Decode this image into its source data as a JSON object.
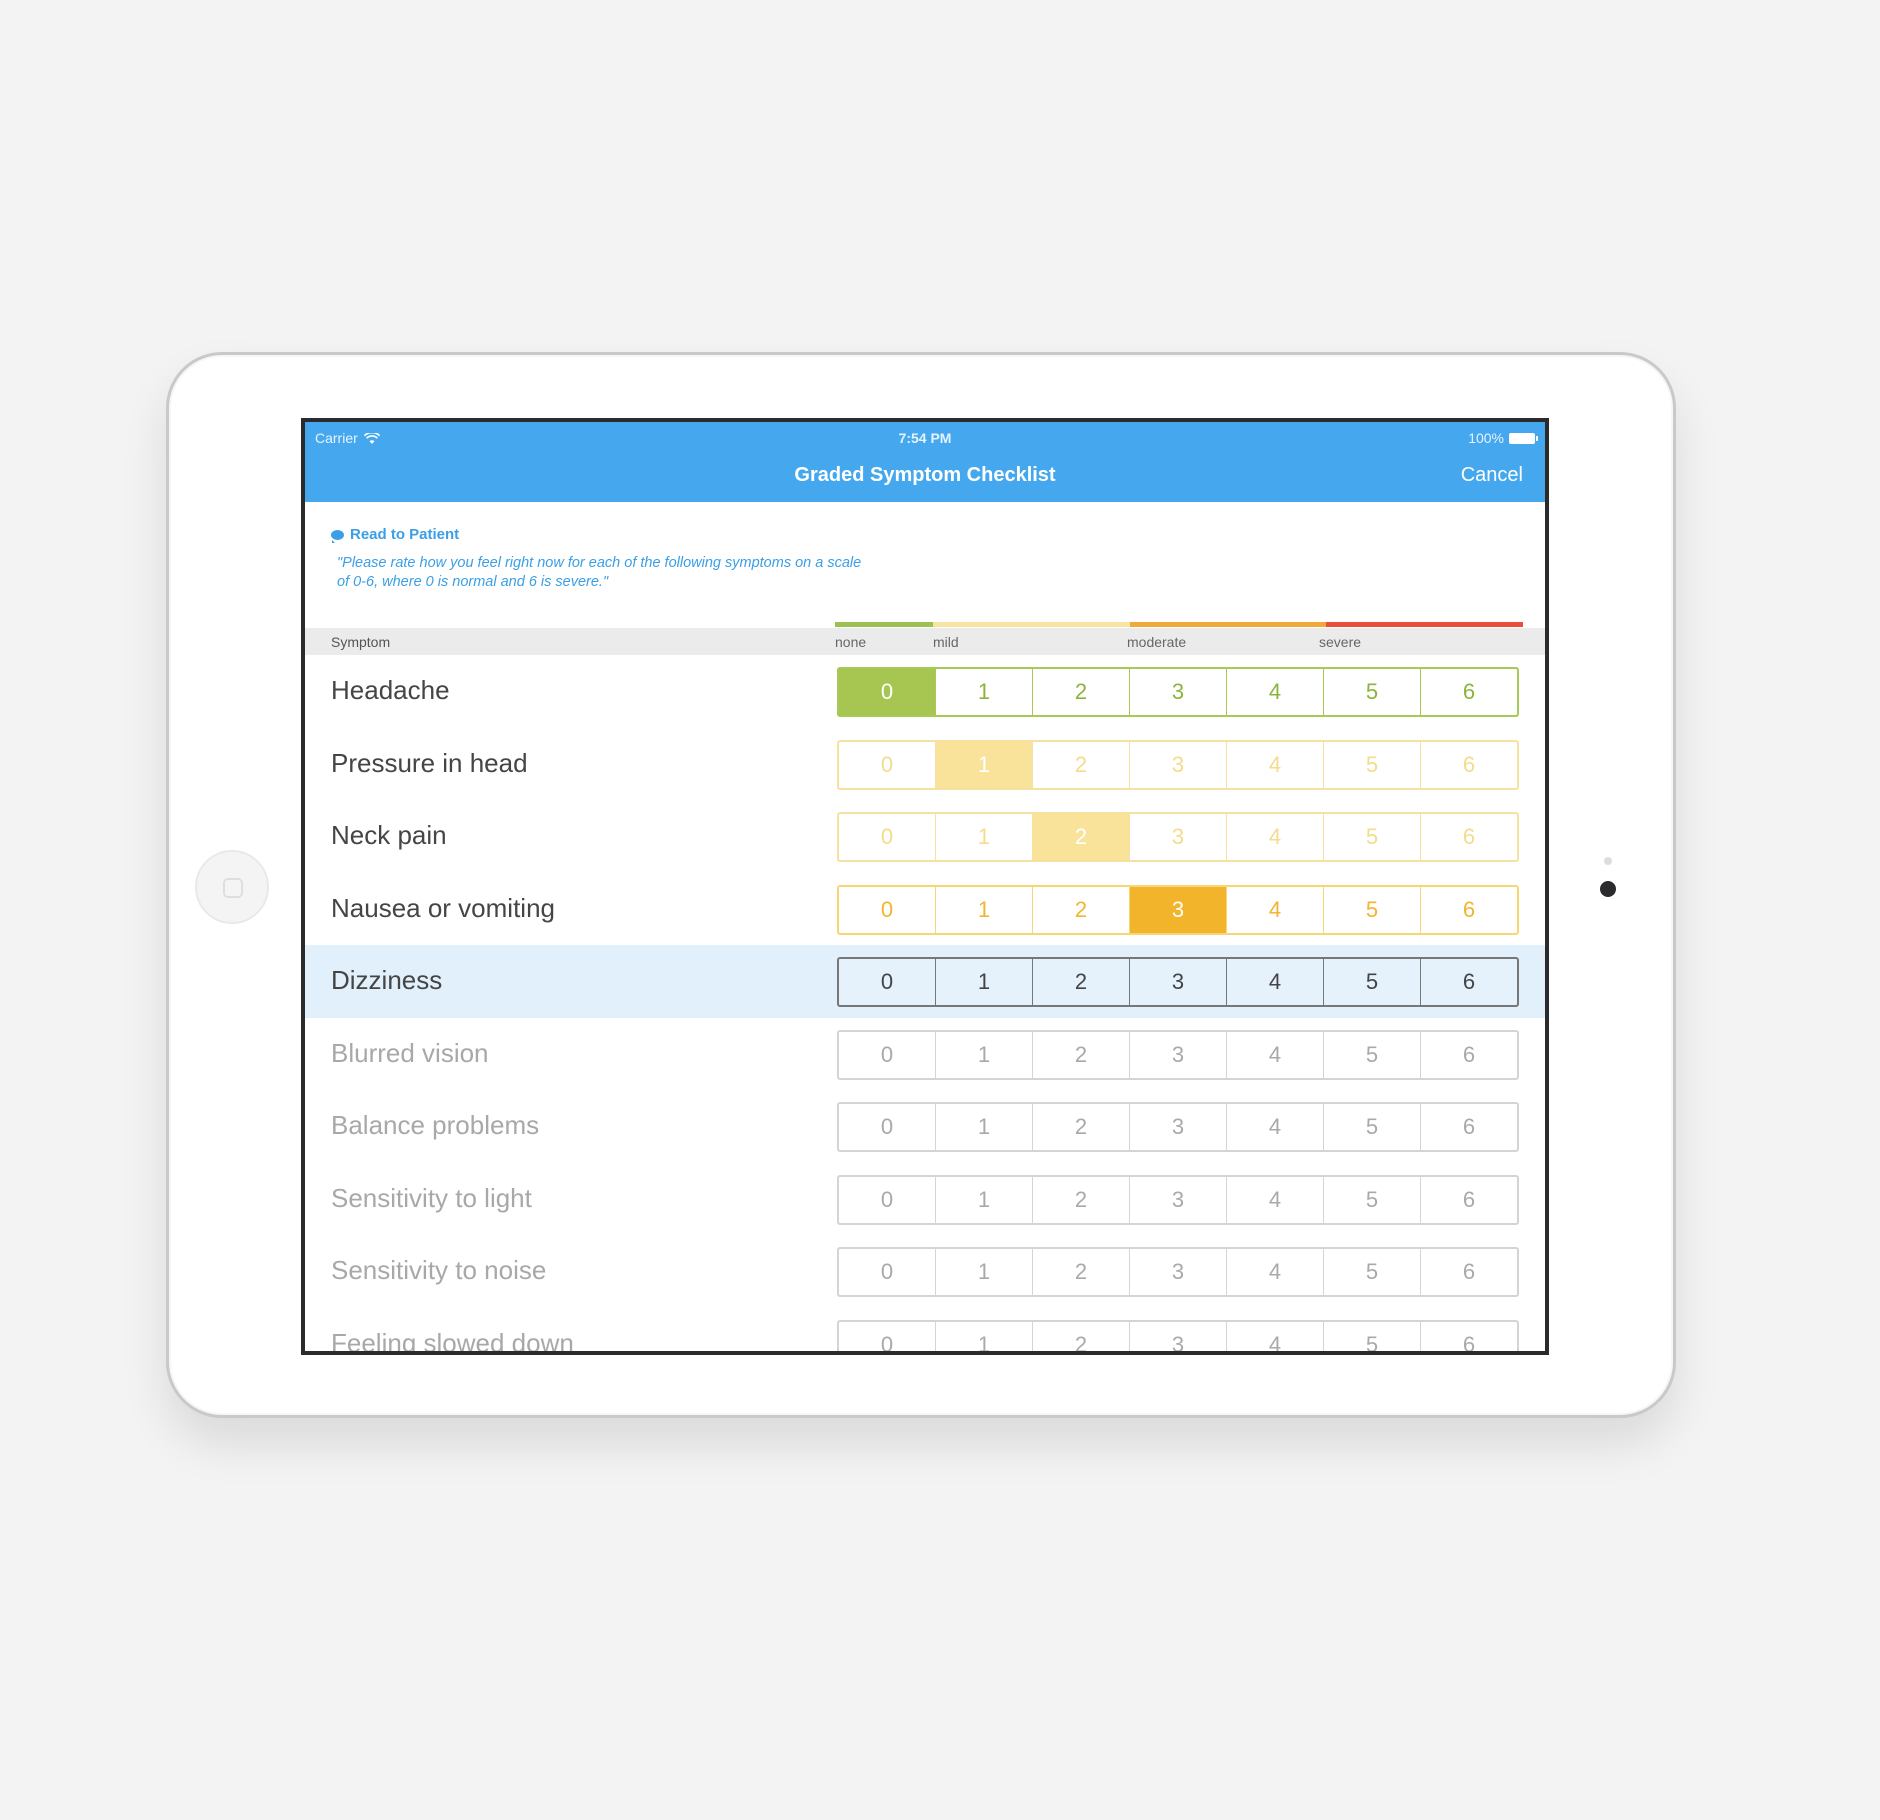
{
  "status_bar": {
    "carrier": "Carrier",
    "time": "7:54 PM",
    "battery": "100%"
  },
  "navbar": {
    "title": "Graded Symptom Checklist",
    "cancel_label": "Cancel"
  },
  "instructions": {
    "label": "Read to Patient",
    "quote": "\"Please rate how you feel right now for each of the following symptoms on a scale of 0-6, where 0 is normal and 6 is severe.\""
  },
  "table_header": {
    "symptom": "Symptom",
    "levels": [
      "none",
      "mild",
      "moderate",
      "severe"
    ]
  },
  "severity_colors": [
    "#9bc153",
    "#f7e3a2",
    "#f7e3a2",
    "#f2a93b",
    "#f2a93b",
    "#e8503a",
    "#e8503a"
  ],
  "scale_values": [
    "0",
    "1",
    "2",
    "3",
    "4",
    "5",
    "6"
  ],
  "symptoms": [
    {
      "name": "Headache",
      "selected": 0,
      "state": "answered-none"
    },
    {
      "name": "Pressure in head",
      "selected": 1,
      "state": "answered-mild"
    },
    {
      "name": "Neck pain",
      "selected": 2,
      "state": "answered-mild"
    },
    {
      "name": "Nausea or vomiting",
      "selected": 3,
      "state": "answered-moderate"
    },
    {
      "name": "Dizziness",
      "selected": null,
      "state": "active"
    },
    {
      "name": "Blurred vision",
      "selected": null,
      "state": "pending"
    },
    {
      "name": "Balance problems",
      "selected": null,
      "state": "pending"
    },
    {
      "name": "Sensitivity to light",
      "selected": null,
      "state": "pending"
    },
    {
      "name": "Sensitivity to noise",
      "selected": null,
      "state": "pending"
    },
    {
      "name": "Feeling slowed down",
      "selected": null,
      "state": "pending"
    }
  ]
}
